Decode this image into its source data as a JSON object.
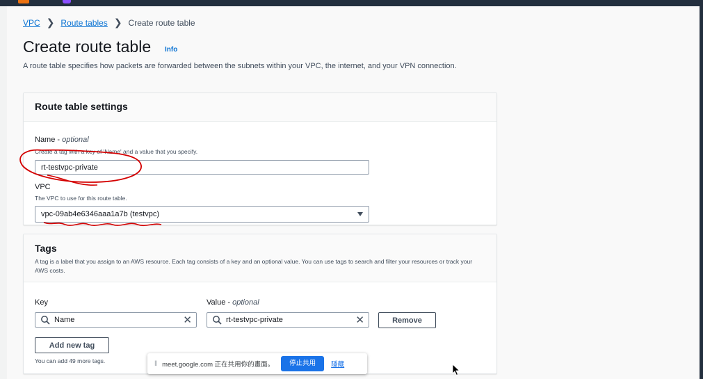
{
  "breadcrumb": {
    "items": [
      "VPC",
      "Route tables"
    ],
    "current": "Create route table"
  },
  "page": {
    "title": "Create route table",
    "info_label": "Info",
    "description": "A route table specifies how packets are forwarded between the subnets within your VPC, the internet, and your VPN connection."
  },
  "settings": {
    "heading": "Route table settings",
    "name_label": "Name",
    "name_optional": "optional",
    "name_hint": "Create a tag with a key of 'Name' and a value that you specify.",
    "name_value": "rt-testvpc-private",
    "vpc_label": "VPC",
    "vpc_hint": "The VPC to use for this route table.",
    "vpc_value": "vpc-09ab4e6346aaa1a7b (testvpc)"
  },
  "tags": {
    "heading": "Tags",
    "description": "A tag is a label that you assign to an AWS resource. Each tag consists of a key and an optional value. You can use tags to search and filter your resources or track your AWS costs.",
    "key_label": "Key",
    "value_label": "Value",
    "value_optional": "optional",
    "rows": [
      {
        "key": "Name",
        "value": "rt-testvpc-private"
      }
    ],
    "remove_label": "Remove",
    "add_label": "Add new tag",
    "remaining": "You can add 49 more tags."
  },
  "meet_bar": {
    "message": "meet.google.com 正在共用你的畫面。",
    "stop_label": "停止共用",
    "hide_label": "隱藏"
  },
  "colors": {
    "link": "#0972d3",
    "nav": "#232f3e",
    "primary_button": "#1a73e8",
    "annotation": "#d40000"
  },
  "icons": [
    "search-icon",
    "clear-icon",
    "chevron-right-icon",
    "caret-down-icon",
    "mouse-cursor-icon"
  ]
}
